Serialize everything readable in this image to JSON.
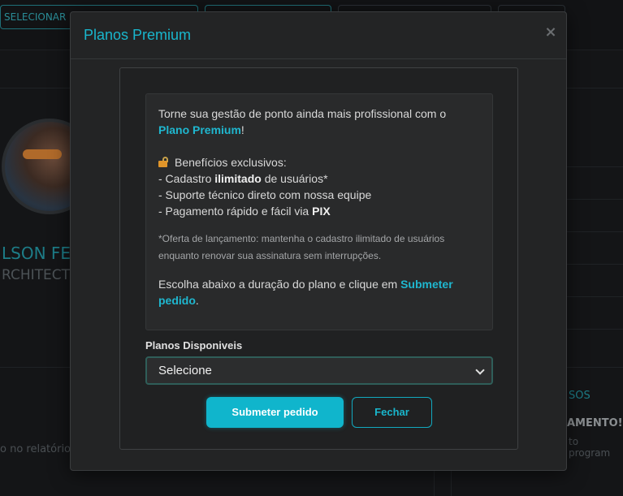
{
  "background": {
    "buttons": [
      {
        "label": "SELECIONAR"
      }
    ],
    "profile_name": "LSON FE",
    "profile_role": "RCHITECT",
    "report_text": "o no relatório",
    "right_label": "SOS",
    "right_bold": "AMENTO!",
    "right_text": "to program"
  },
  "modal": {
    "title": "Planos Premium",
    "close_glyph": "×",
    "intro_text": "Torne sua gestão de ponto ainda mais profissional com o",
    "intro_highlight": "Plano Premium",
    "intro_end": "!",
    "benefits_heading": "Benefícios exclusivos:",
    "benefit_1_prefix": "- Cadastro",
    "benefit_1_bold": "ilimitado",
    "benefit_1_suffix": "de usuários*",
    "benefit_2": "- Suporte técnico direto com nossa equipe",
    "benefit_3_prefix": "- Pagamento rápido e fácil via",
    "benefit_3_bold": "PIX",
    "note": "*Oferta de lançamento: mantenha o cadastro ilimitado de usuários enquanto renovar sua assinatura sem interrupções.",
    "choose_text": "Escolha abaixo a duração do plano e clique em",
    "choose_highlight": "Submeter pedido",
    "choose_end": ".",
    "select_label": "Planos Disponiveis",
    "select_value": "Selecione",
    "submit_label": "Submeter pedido",
    "close_label": "Fechar"
  },
  "icons": {
    "lock": "lock-icon",
    "chevron": "chevron-down-icon"
  },
  "colors": {
    "accent": "#10b5cc",
    "title": "#19b6cc",
    "lock": "#e0952a"
  }
}
